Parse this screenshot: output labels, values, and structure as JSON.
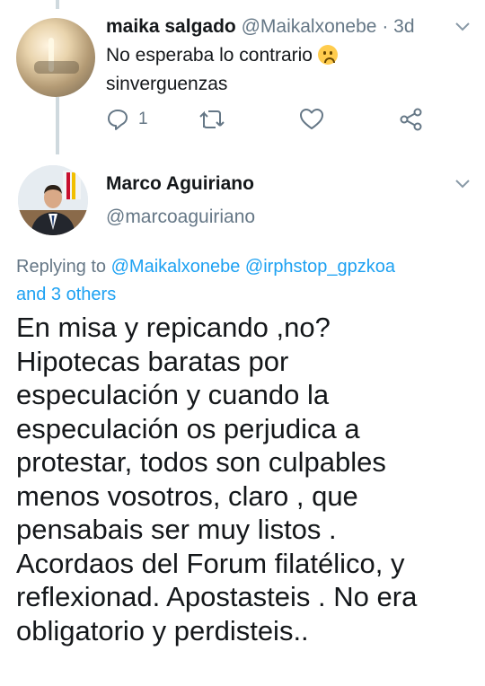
{
  "tweet1": {
    "name": "maika salgado",
    "handle": "@Maikalxonebe",
    "time": "3d",
    "text_line1": "No esperaba lo contrario",
    "text_line2": "sinverguenzas",
    "emoji": "worried-face-emoji",
    "reply_count": "1"
  },
  "tweet2": {
    "name": "Marco Aguiriano",
    "handle": "@marcoaguiriano",
    "replying_prefix": "Replying to",
    "mention1": "@Maikalxonebe",
    "mention2": "@irphstop_gpzkoa",
    "mention_others": "and 3 others",
    "body_lines": [
      "En misa y repicando ,no?",
      "Hipotecas baratas por",
      "especulación y cuando la",
      "especulación os perjudica a",
      "protestar, todos son culpables",
      "menos vosotros, claro , que",
      "pensabais ser muy listos .",
      "Acordaos del Forum filatélico, y",
      "reflexionad. Apostasteis . No era",
      "obligatorio y perdisteis.."
    ]
  },
  "colors": {
    "text": "#14171a",
    "secondary": "#657786",
    "link": "#1da1f2",
    "thread": "#cfd9de"
  }
}
